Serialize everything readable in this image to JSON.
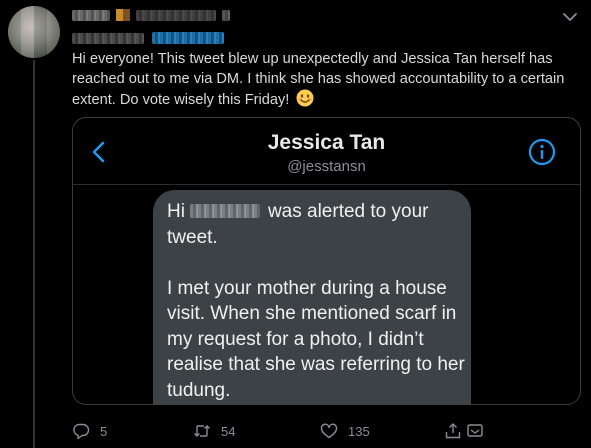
{
  "tweet": {
    "text": "Hi everyone! This tweet blew up unexpectedly and Jessica Tan herself has reached out to me via DM. I think she has showed accountability to a certain extent. Do vote wisely this Friday!",
    "emoji": "smiling-face-emoji"
  },
  "embed": {
    "contact_name": "Jessica Tan",
    "contact_handle": "@jesstansn",
    "message_greeting": "Hi",
    "message_line1_rest": "was alerted to your tweet.",
    "message_paragraph2": "I met your mother during a house visit. When she mentioned scarf in my request for a photo, I didn’t realise that she was referring to her tudung."
  },
  "actions": {
    "replies": "5",
    "retweets": "54",
    "likes": "135"
  },
  "icons": {
    "back": "chevron-left-icon",
    "info": "info-icon",
    "more": "chevron-down-icon",
    "reply": "reply-icon",
    "retweet": "retweet-icon",
    "like": "heart-icon",
    "share": "share-icon"
  },
  "colors": {
    "background": "#000000",
    "accent": "#1d9bf0",
    "text": "#d9d9d9",
    "muted": "#8b8f94",
    "bubble": "#3d4247"
  }
}
